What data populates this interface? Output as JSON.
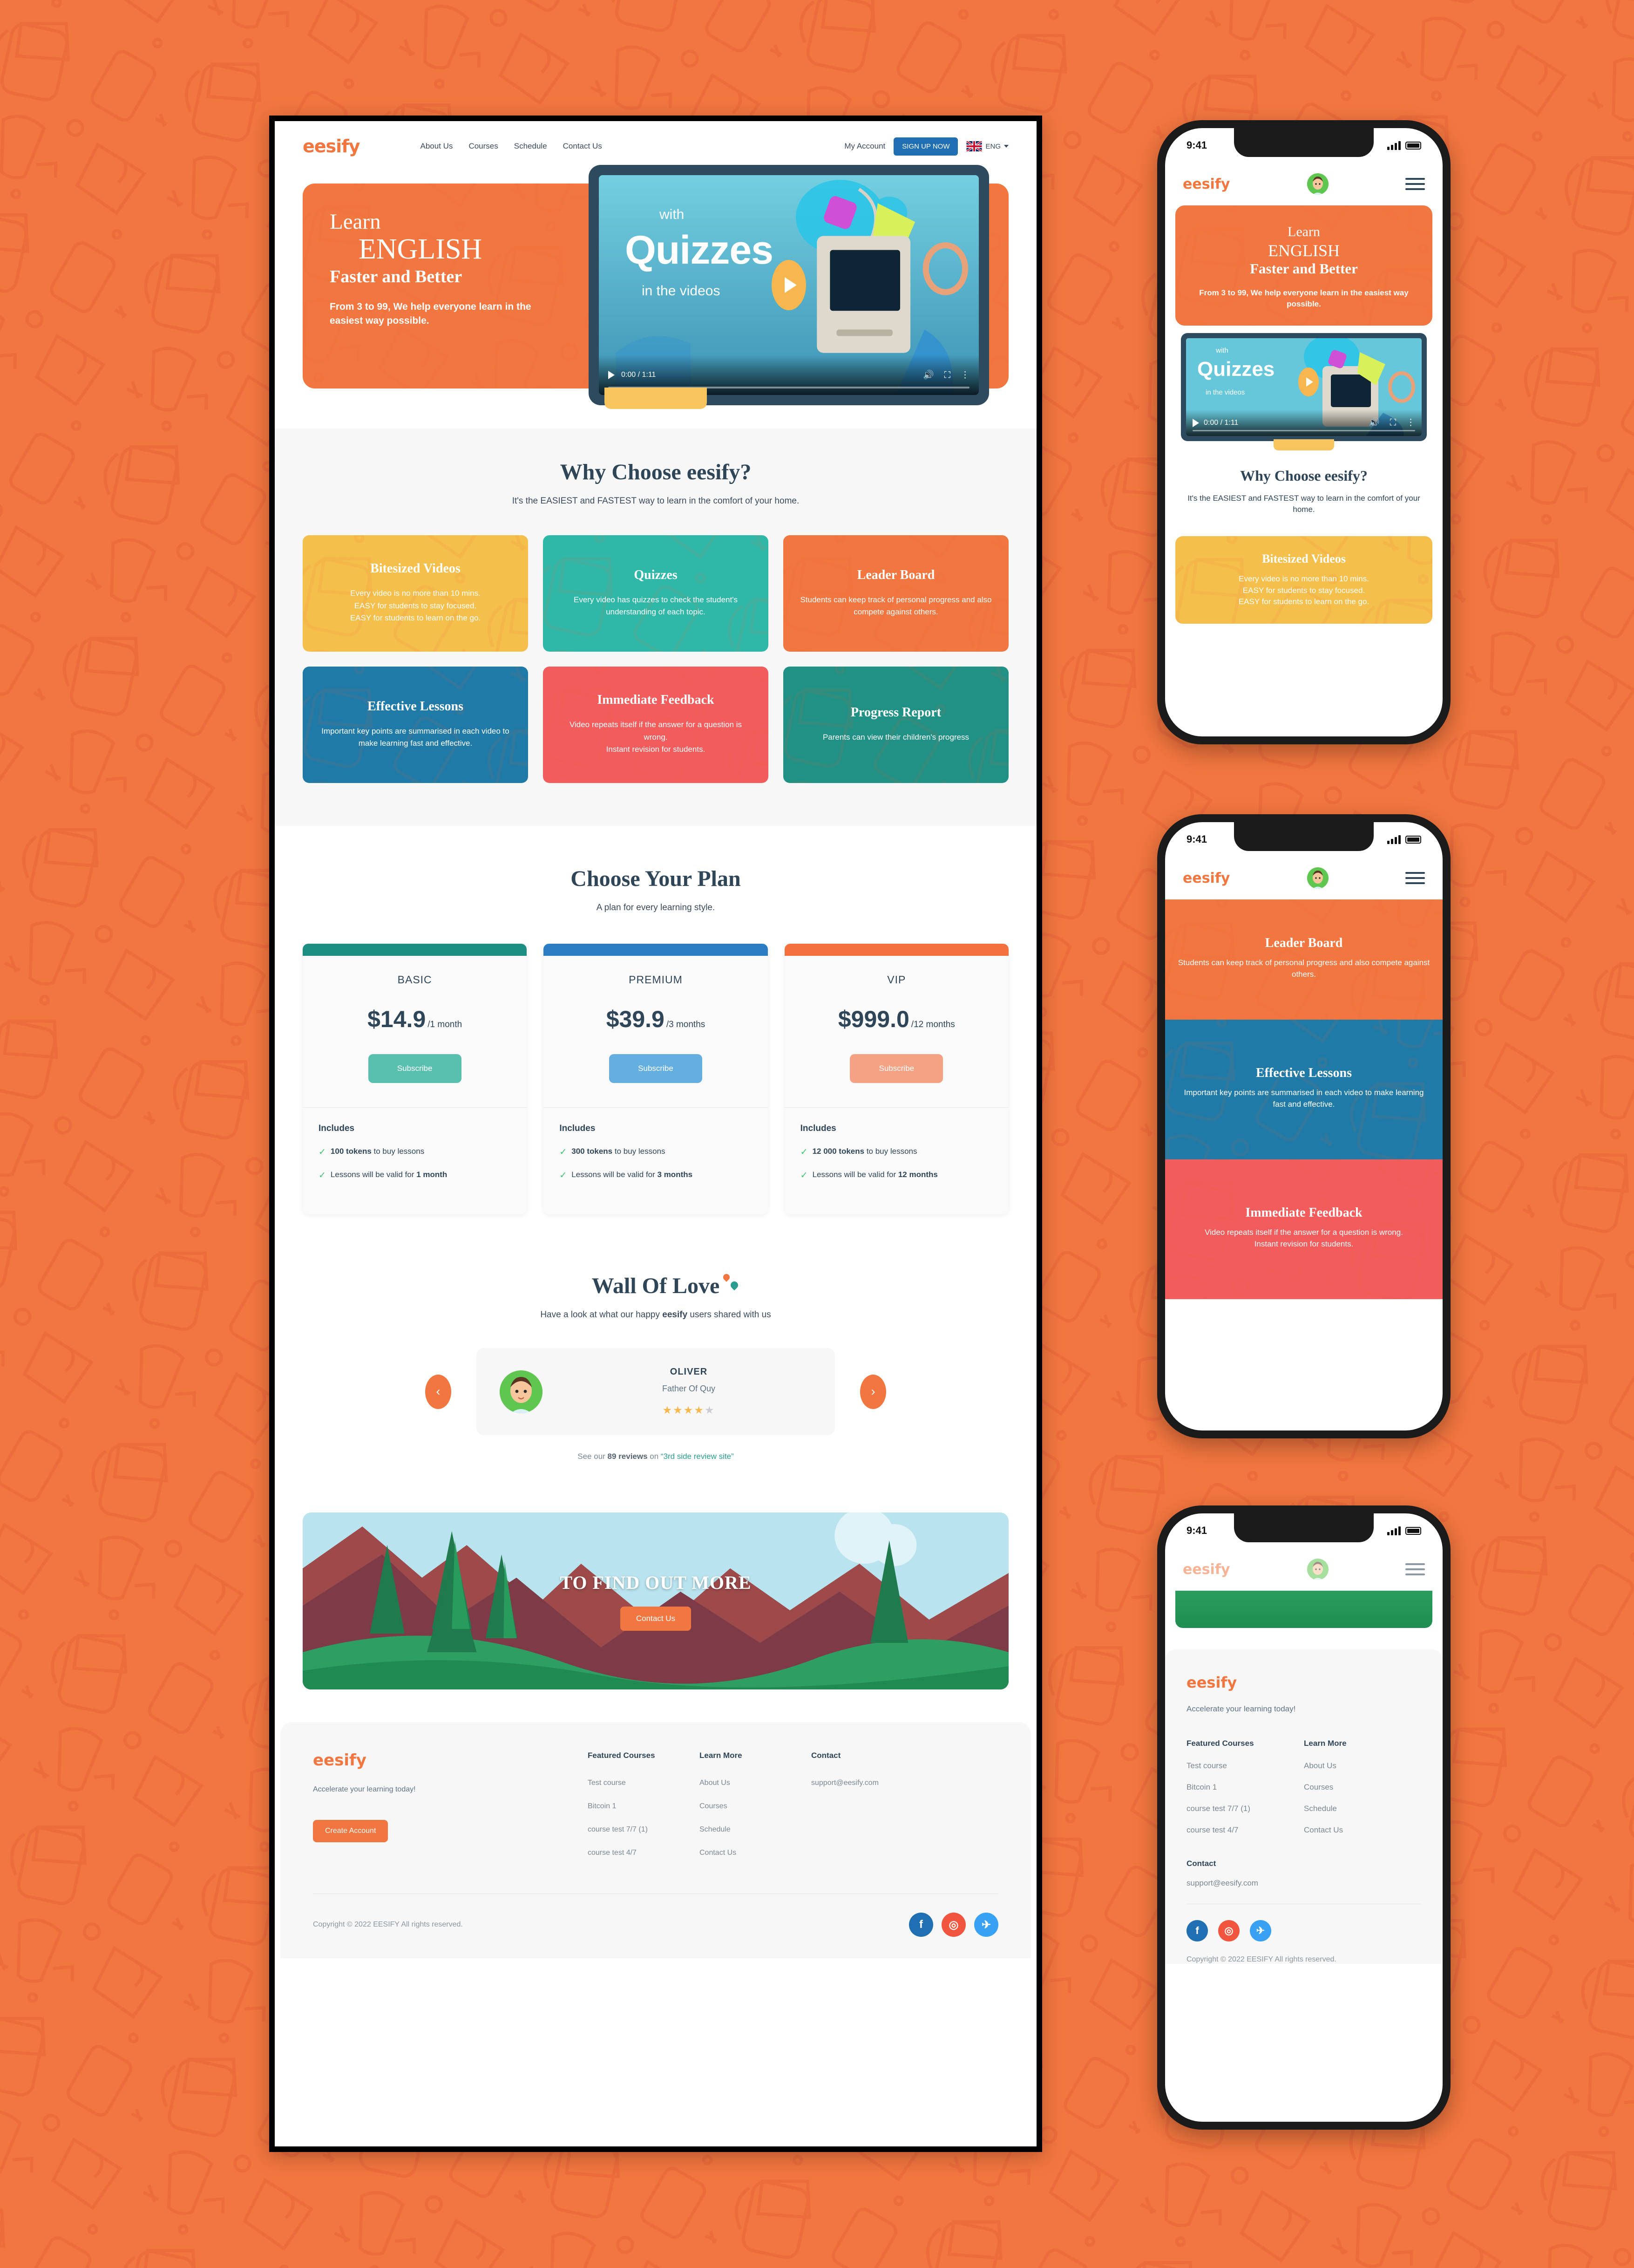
{
  "colors": {
    "brand_orange": "#f2763f",
    "deep_navy": "#2f4558",
    "yellow": "#f5bf4c",
    "teal": "#2fb8a8",
    "blue": "#1f7aa8",
    "red": "#f25c5c",
    "green_teal": "#209184",
    "page_bg": "#f2763f"
  },
  "header": {
    "logo": "eesify",
    "nav": [
      {
        "label": "About Us"
      },
      {
        "label": "Courses"
      },
      {
        "label": "Schedule"
      },
      {
        "label": "Contact Us"
      }
    ],
    "my_account": "My Account",
    "signup_label": "SIGN UP NOW",
    "lang_label": "ENG",
    "flag_icon": "uk-flag-icon"
  },
  "hero": {
    "line1": "Learn",
    "line2": "ENGLISH",
    "line3": "Faster and Better",
    "subtitle": "From 3 to 99, We help everyone learn in the easiest way possible.",
    "video": {
      "overlay_top": "with",
      "overlay_main": "Quizzes",
      "overlay_bottom": "in the videos",
      "time": "0:00 / 1:11",
      "play_icon": "play-icon",
      "volume_icon": "volume-icon",
      "fullscreen_icon": "fullscreen-icon",
      "more_icon": "more-options-icon"
    }
  },
  "why": {
    "title": "Why Choose eesify?",
    "subtitle": "It's the EASIEST and FASTEST way to learn in the comfort of your home.",
    "cards": [
      {
        "title": "Bitesized Videos",
        "body": "Every video is no more than 10 mins.\nEASY for students to stay focused.\nEASY for students to learn on the go.",
        "color": "#f5bf4c"
      },
      {
        "title": "Quizzes",
        "body": "Every video has quizzes to check the student's understanding of each topic.",
        "color": "#2fb8a8"
      },
      {
        "title": "Leader Board",
        "body": "Students can keep track of personal progress and also compete against others.",
        "color": "#f2763f"
      },
      {
        "title": "Effective Lessons",
        "body": "Important key points are summarised in each video to make learning fast and effective.",
        "color": "#1f7aa8"
      },
      {
        "title": "Immediate Feedback",
        "body": "Video repeats itself if the answer for a question is wrong.\nInstant revision for students.",
        "color": "#f25c5c"
      },
      {
        "title": "Progress Report",
        "body": "Parents can view their children's progress",
        "color": "#209184"
      }
    ]
  },
  "pricing": {
    "title": "Choose Your Plan",
    "subtitle": "A plan for every learning style.",
    "includes_label": "Includes",
    "plans": [
      {
        "name": "BASIC",
        "price": "$14.9",
        "period": "/1 month",
        "button": "Subscribe",
        "accent": "#1d8f82",
        "button_color": "#59bfae",
        "features": [
          {
            "strong": "100 tokens",
            "rest": " to buy lessons"
          },
          {
            "strong": "",
            "rest": "Lessons will be valid for ",
            "strong_after": "1 month"
          }
        ]
      },
      {
        "name": "PREMIUM",
        "price": "$39.9",
        "period": "/3 months",
        "button": "Subscribe",
        "accent": "#2b7dc4",
        "button_color": "#64aee0",
        "features": [
          {
            "strong": "300 tokens",
            "rest": " to buy lessons"
          },
          {
            "strong": "",
            "rest": "Lessons will be valid for ",
            "strong_after": "3 months"
          }
        ]
      },
      {
        "name": "VIP",
        "price": "$999.0",
        "period": "/12 months",
        "button": "Subscribe",
        "accent": "#f4703c",
        "button_color": "#f5a183",
        "features": [
          {
            "strong": "12 000 tokens",
            "rest": " to buy lessons"
          },
          {
            "strong": "",
            "rest": "Lessons will be valid for ",
            "strong_after": "12 months"
          }
        ]
      }
    ]
  },
  "wall_of_love": {
    "title": "Wall Of Love",
    "subtitle_pre": "Have a look at what our happy ",
    "subtitle_brand": "eesify",
    "subtitle_post": " users shared with us",
    "prev_icon": "chevron-left-icon",
    "next_icon": "chevron-right-icon",
    "testimonial": {
      "name": "OLIVER",
      "role": "Father Of Quy",
      "rating": 4,
      "max_rating": 5
    },
    "review_pre": "See our ",
    "review_count": "89 reviews",
    "review_mid": " on ",
    "review_site": "“3rd side review site”"
  },
  "cta": {
    "title": "TO FIND OUT MORE",
    "button": "Contact Us"
  },
  "footer": {
    "logo": "eesify",
    "tagline": "Accelerate your learning today!",
    "cta_button": "Create Account",
    "columns": [
      {
        "heading": "Featured Courses",
        "links": [
          "Test course",
          "Bitcoin 1",
          "course test 7/7 (1)",
          "course test 4/7"
        ]
      },
      {
        "heading": "Learn More",
        "links": [
          "About Us",
          "Courses",
          "Schedule",
          "Contact Us"
        ]
      }
    ],
    "contact_heading": "Contact",
    "contact_email": "support@eesify.com",
    "copyright": "Copyright © 2022 EESIFY All rights reserved.",
    "socials": [
      {
        "name": "facebook-icon",
        "glyph": "f",
        "color": "#1f6fb2"
      },
      {
        "name": "instagram-icon",
        "glyph": "◎",
        "color": "#f2553d"
      },
      {
        "name": "twitter-icon",
        "glyph": "✈",
        "color": "#38a1f3"
      }
    ]
  },
  "phones": [
    {
      "status_time": "9:41",
      "logo": "eesify",
      "avatar_icon": "user-avatar-icon",
      "menu_icon": "hamburger-menu-icon"
    },
    {
      "status_time": "9:41",
      "logo": "eesify",
      "avatar_icon": "user-avatar-icon",
      "menu_icon": "hamburger-menu-icon"
    },
    {
      "status_time": "9:41",
      "logo": "eesify",
      "avatar_icon": "user-avatar-icon",
      "menu_icon": "hamburger-menu-icon"
    }
  ]
}
